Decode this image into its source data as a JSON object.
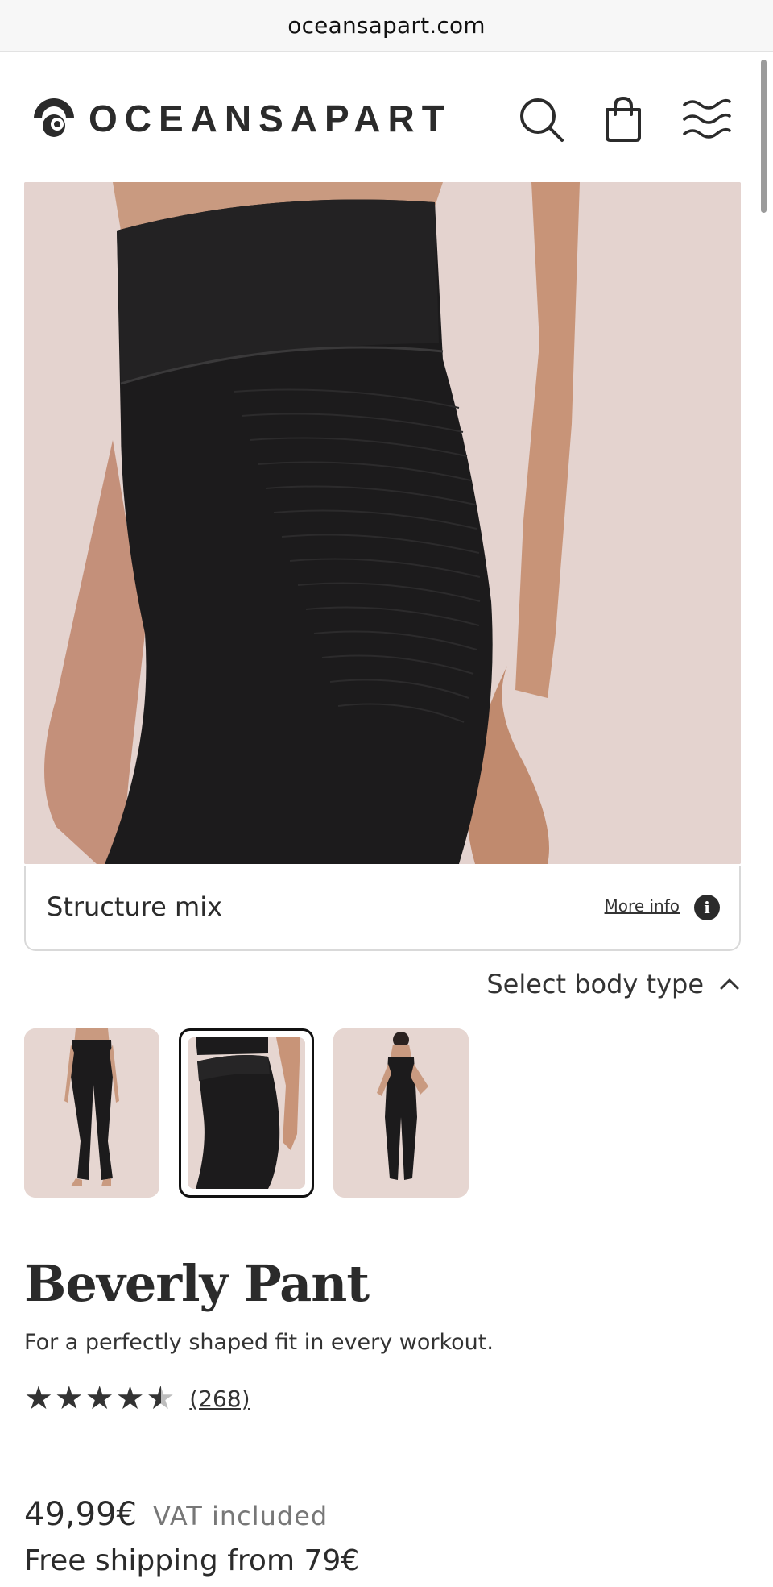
{
  "browser": {
    "url": "oceansapart.com"
  },
  "header": {
    "logo_text": "OCEANSAPART",
    "icons": [
      "logo-icon",
      "search-icon",
      "bag-icon",
      "menu-icon"
    ]
  },
  "hero": {
    "image_label": "Structure mix",
    "more_info": "More info",
    "info_glyph": "i"
  },
  "body_type": {
    "label": "Select body type"
  },
  "product": {
    "name": "Beverly Pant",
    "tagline": "For a perfectly shaped fit in every workout.",
    "rating": {
      "stars": 4.5,
      "count": "(268)"
    },
    "price": "49,99€",
    "vat": "VAT included",
    "shipping": "Free shipping from 79€"
  },
  "colors": {
    "accent": "#2b2b2b",
    "image_bg": "#e4d3cf"
  }
}
